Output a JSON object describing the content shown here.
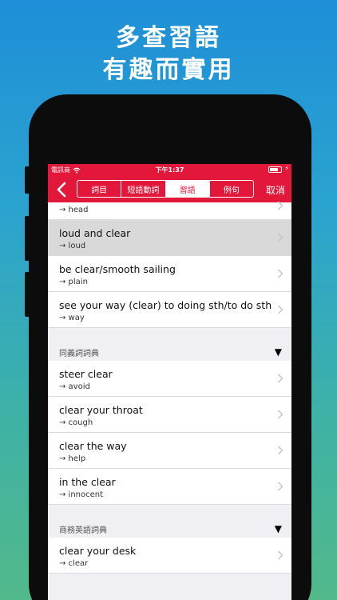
{
  "headline": {
    "line1": "多查習語",
    "line2": "有趣而實用"
  },
  "status_bar": {
    "carrier": "電訊商",
    "time": "下午1:37",
    "battery_level": 0.8
  },
  "nav": {
    "tabs": [
      {
        "label": "詞目",
        "active": false
      },
      {
        "label": "短語動詞",
        "active": false
      },
      {
        "label": "習語",
        "active": true
      },
      {
        "label": "例句",
        "active": false
      }
    ],
    "cancel_label": "取消"
  },
  "results": {
    "top_partial": {
      "sub": "→ head"
    },
    "rows": [
      {
        "title": "loud and clear",
        "sub": "→ loud",
        "highlighted": true
      },
      {
        "title": "be clear/smooth sailing",
        "sub": "→ plain"
      },
      {
        "title": "see your way (clear) to doing sth/to do sth",
        "sub": "→ way"
      }
    ]
  },
  "sections": [
    {
      "header": "同義詞詞典",
      "toggle": "▼",
      "rows": [
        {
          "title": "steer clear",
          "sub": "→ avoid"
        },
        {
          "title": "clear your throat",
          "sub": "→ cough"
        },
        {
          "title": "clear the way",
          "sub": "→ help"
        },
        {
          "title": "in the clear",
          "sub": "→ innocent"
        }
      ]
    },
    {
      "header": "商務英語詞典",
      "toggle": "▼",
      "rows": [
        {
          "title": "clear your desk",
          "sub": "→ clear"
        }
      ]
    }
  ],
  "icons": {
    "wifi": "wifi-icon",
    "battery": "battery-icon",
    "back": "chevron-left-icon",
    "row": "chevron-right-icon"
  },
  "colors": {
    "accent": "#e3173a",
    "highlight": "#d9d9d9",
    "group_bg": "#f0eff4"
  }
}
